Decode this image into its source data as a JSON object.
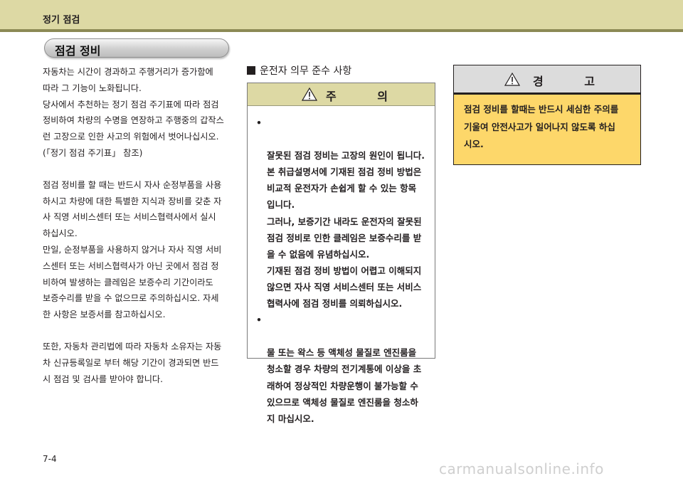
{
  "header": {
    "running_title": "정기 점검"
  },
  "section": {
    "title": "점검 정비"
  },
  "left_column": {
    "paragraphs": [
      "자동차는 시간이 경과하고 주행거리가 증가함에\n따라 그 기능이 노화됩니다.\n당사에서 추천하는 정기 점검 주기표에 따라 점검\n정비하여 차량의 수명을 연장하고 주행중의 갑작스\n런 고장으로 인한 사고의 위험에서 벗어나십시오.\n(「정기 점검 주기표」 참조)",
      "점검 정비를 할 때는 반드시 자사 순정부품을 사용\n하시고 차량에 대한 특별한 지식과 장비를 갖춘 자\n사 직영 서비스센터 또는 서비스협력사에서 실시\n하십시오.\n만일, 순정부품을 사용하지 않거나 자사 직영 서비\n스센터 또는 서비스협력사가 아닌 곳에서 점검 정\n비하여 발생하는 클레임은 보증수리 기간이라도\n보증수리를 받을 수 없으므로 주의하십시오. 자세\n한 사항은 보증서를 참고하십시오.",
      "또한, 자동차 관리법에 따라 자동차 소유자는 자동\n차 신규등록일로 부터 해당 기간이 경과되면 반드\n시 점검 및 검사를 받아야 합니다."
    ]
  },
  "middle_column": {
    "heading": "운전자 의무 준수 사항",
    "caution": {
      "title": "주 의",
      "bullet_mark": "•",
      "items": [
        "잘못된 점검 정비는 고장의 원인이 됩니다.\n본 취급설명서에 기재된 점검 정비 방법은\n비교적 운전자가 손쉽게 할 수 있는 항목\n입니다.\n그러나, 보증기간 내라도 운전자의 잘못된\n점검 정비로 인한 클레임은 보증수리를 받\n을 수 없음에 유념하십시오.\n기재된 점검 정비 방법이 어렵고 이해되지\n않으면 자사 직영 서비스센터 또는 서비스\n협력사에 점검 정비를 의뢰하십시오.",
        "물 또는 왁스 등 액체성 물질로 엔진룸을\n청소할 경우 차량의 전기계통에 이상을 초\n래하여 정상적인 차량운행이 불가능할 수\n있으므로 액체성 물질로 엔진룸을 청소하\n지 마십시오."
      ]
    }
  },
  "right_column": {
    "warning": {
      "title": "경 고",
      "text": "점검 정비를 할때는 반드시 세심한 주의를\n기울여 안전사고가 일어나지 않도록 하십\n시오."
    }
  },
  "footer": {
    "page_number": "7-4",
    "watermark": "carmanualsonline.info"
  },
  "colors": {
    "header_band": "#ddd9a4",
    "header_rule": "#8c8a55",
    "warning_fill": "#fdd76a",
    "warning_head": "#dcdcdc"
  }
}
